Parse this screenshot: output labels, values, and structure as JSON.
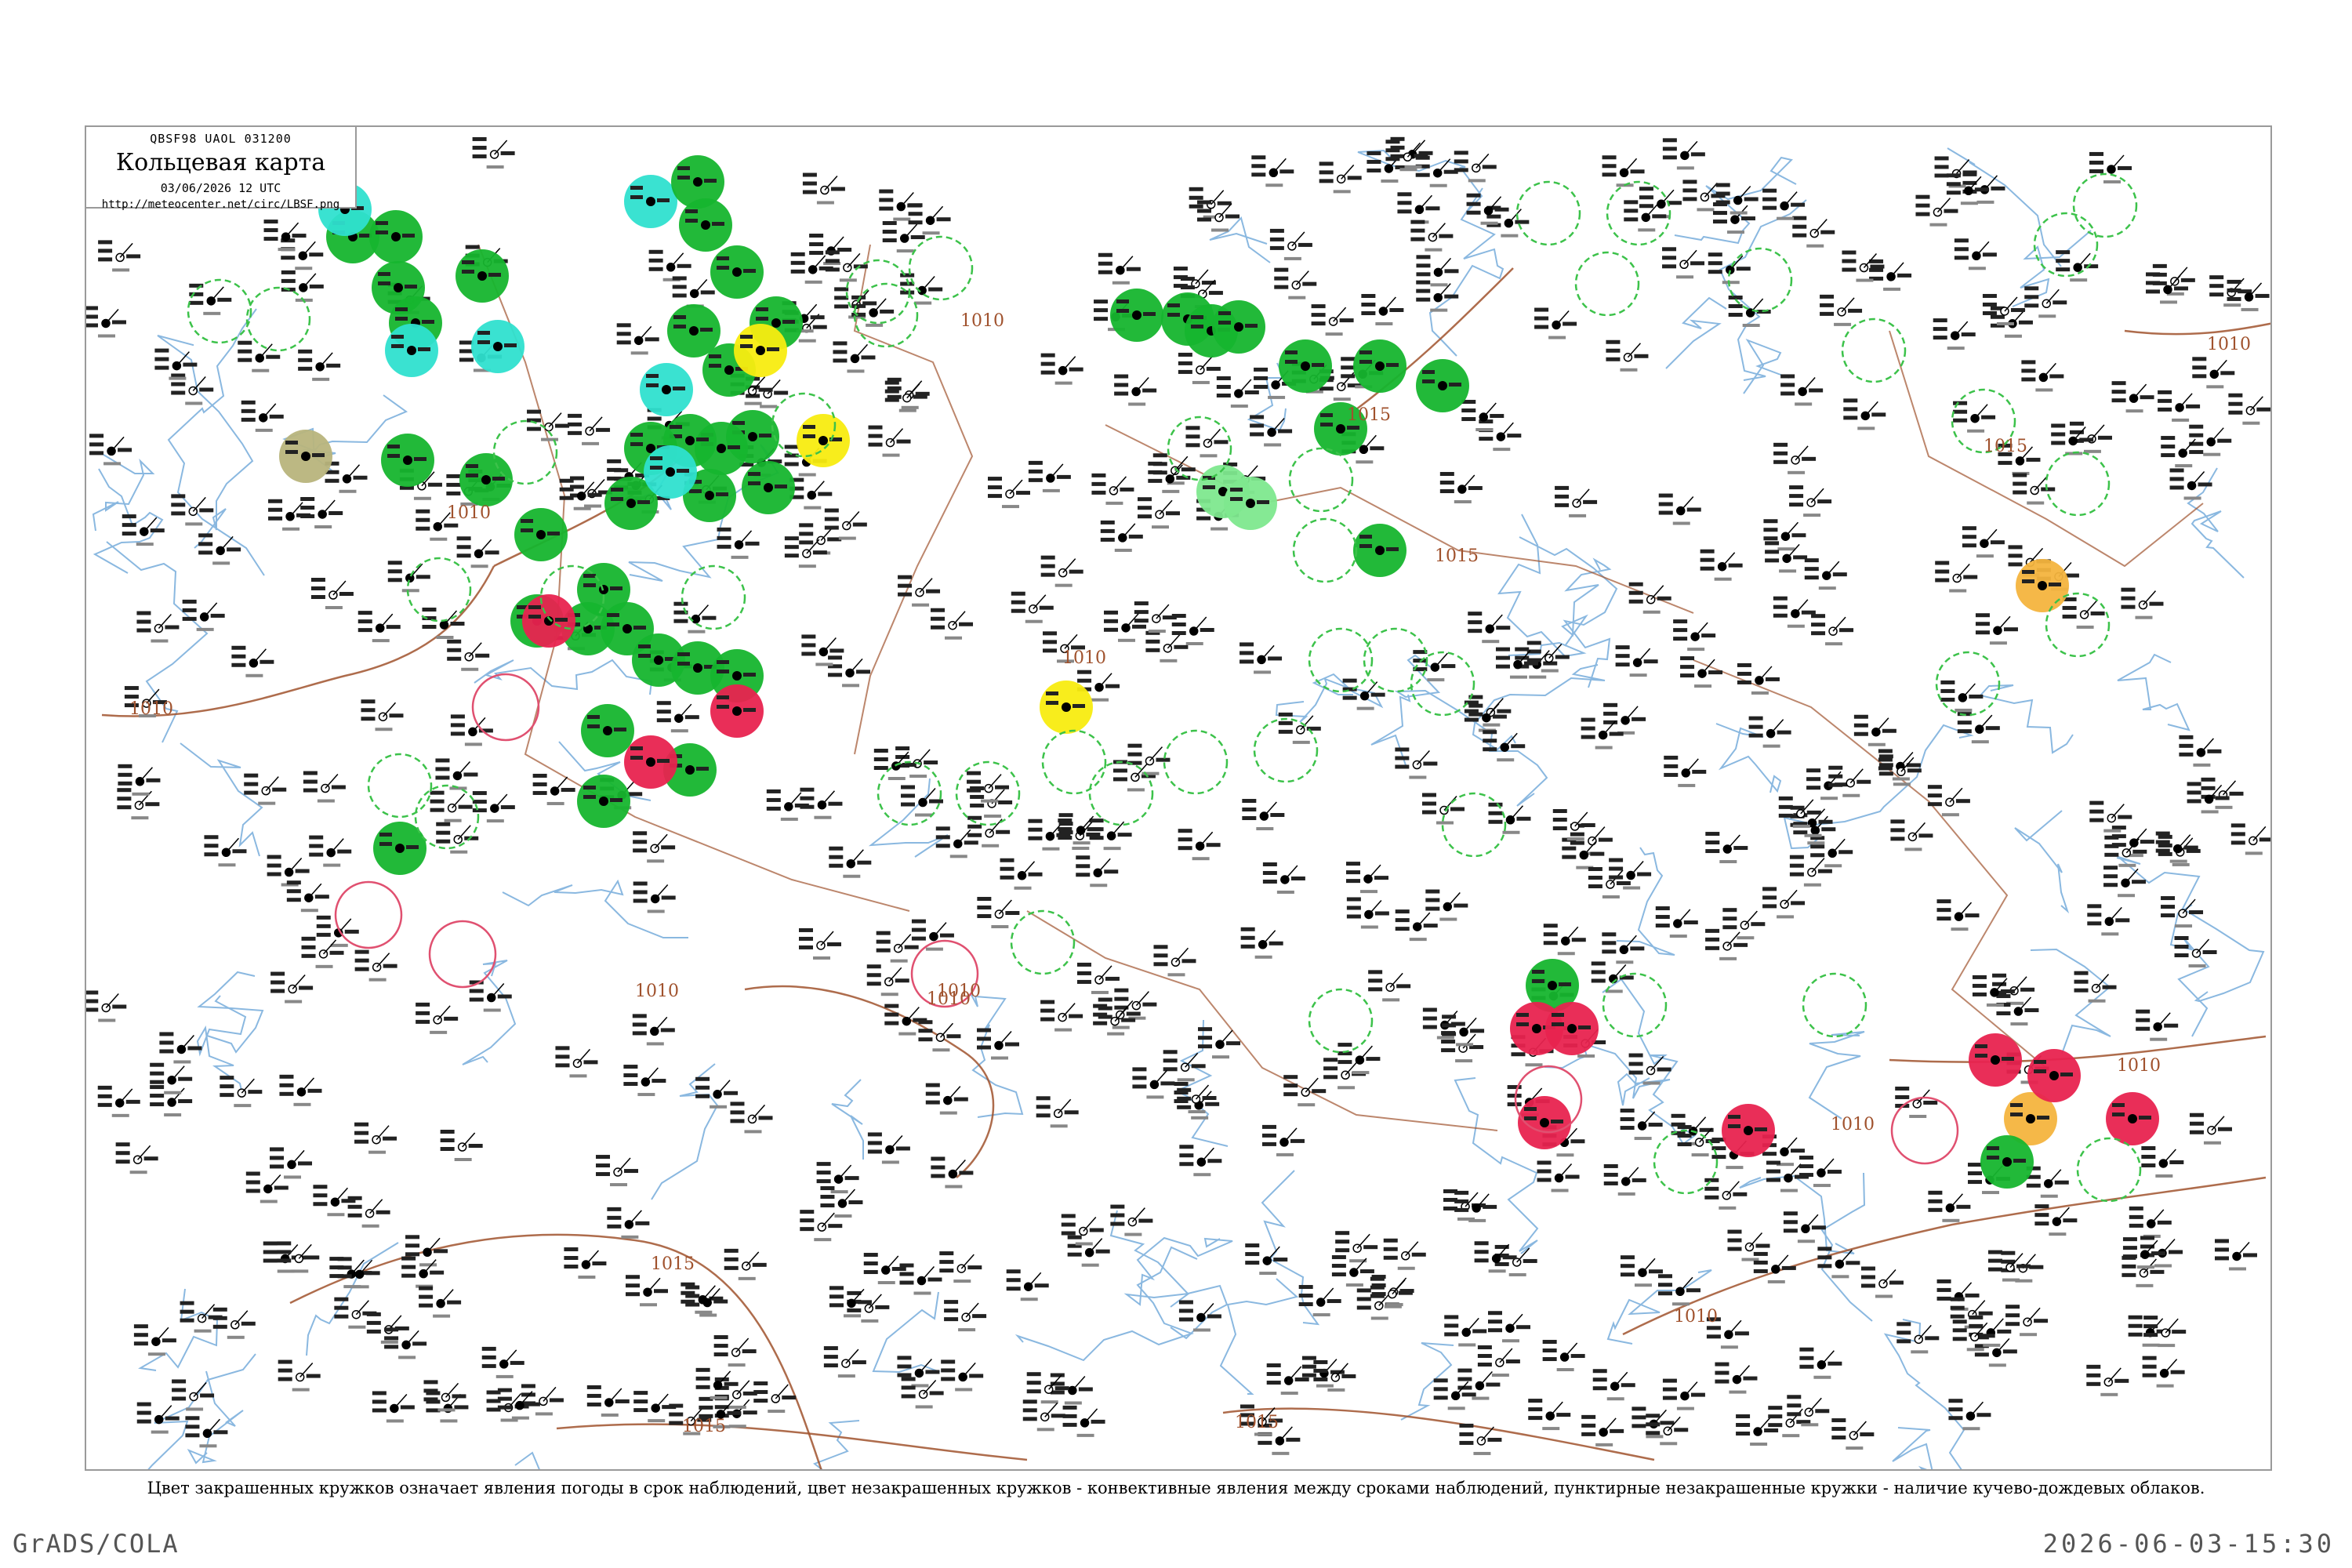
{
  "header": {
    "code_line": "QBSF98 UAOL 031200",
    "title": "Кольцевая карта",
    "date_line": "03/06/2026 12 UTC",
    "url": "http://meteocenter.net/circ/LBSF.png"
  },
  "caption": "Цвет закрашенных кружков означает явления погоды в срок наблюдений, цвет незакрашенных кружков - конвективные явления между сроками наблюдений, пунктирные незакрашенные кружки - наличие кучево-дождевых облаков.",
  "footer": {
    "left": "GrADS/COLA",
    "right": "2026-06-03-15:30"
  },
  "isobar_labels": [
    {
      "text": "1010"
    },
    {
      "text": "1010"
    },
    {
      "text": "1010"
    },
    {
      "text": "1015"
    },
    {
      "text": "1015"
    },
    {
      "text": "1010"
    },
    {
      "text": "1010"
    },
    {
      "text": "1010"
    },
    {
      "text": "1015"
    },
    {
      "text": "1015"
    },
    {
      "text": "1015"
    },
    {
      "text": "1010"
    },
    {
      "text": "1010"
    },
    {
      "text": "1010"
    },
    {
      "text": "1015"
    },
    {
      "text": "1010"
    },
    {
      "text": "1010"
    }
  ],
  "colors": {
    "green_fill": "#16b52e",
    "cyan_fill": "#2fe0cf",
    "red_fill": "#e8234f",
    "yellow_fill": "#f8ec10",
    "orange_fill": "#f4b43e",
    "olive_fill": "#b8b47c",
    "light_green_fill": "#7ee88e",
    "dashed_green": "#3cc24a",
    "red_ring": "#e05070",
    "isobar": "#a0522d",
    "river": "#8ab8e0",
    "border": "#a0522d"
  }
}
